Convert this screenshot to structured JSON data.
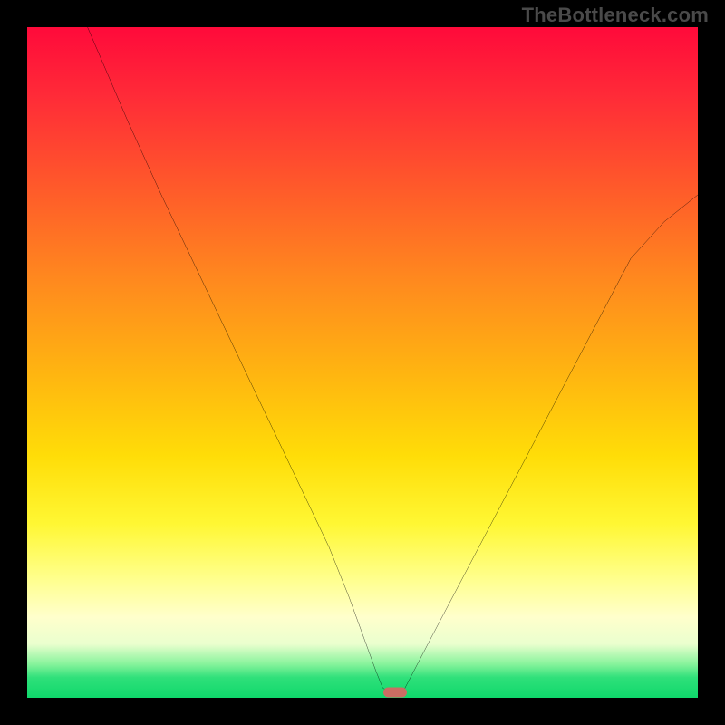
{
  "watermark": "TheBottleneck.com",
  "chart_data": {
    "type": "line",
    "title": "",
    "xlabel": "",
    "ylabel": "",
    "xlim": [
      0,
      100
    ],
    "ylim": [
      0,
      100
    ],
    "grid": false,
    "series": [
      {
        "name": "curve",
        "x": [
          9,
          15,
          20,
          25,
          30,
          35,
          40,
          45,
          48,
          50,
          52,
          53,
          54,
          55,
          56,
          60,
          65,
          70,
          75,
          80,
          85,
          90,
          95,
          100
        ],
        "values": [
          100,
          86,
          75,
          64.5,
          54,
          43.5,
          33,
          22.5,
          15,
          9.5,
          4,
          1.5,
          0.8,
          0.8,
          0.8,
          8.5,
          18,
          27.5,
          37,
          46.5,
          56,
          65.5,
          71,
          75
        ]
      }
    ],
    "marker": {
      "x": 54.8,
      "y": 0.8
    },
    "colors": {
      "curve": "#000000",
      "marker": "#cc6d63",
      "gradient": [
        "#ff0a3a",
        "#ff5a2a",
        "#ffb610",
        "#fff733",
        "#ffffcc",
        "#2fe07a"
      ]
    }
  }
}
